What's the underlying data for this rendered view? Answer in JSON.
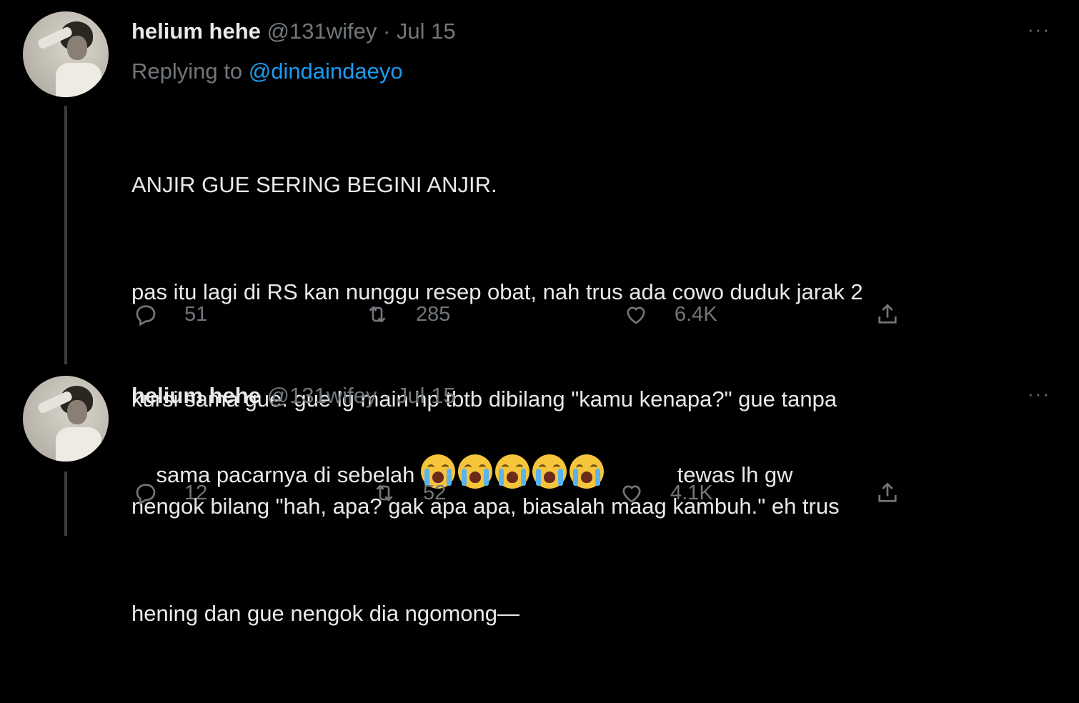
{
  "tweets": [
    {
      "name": "helium hehe",
      "handle": "@131wifey",
      "separator": "·",
      "date": "Jul 15",
      "more": "···",
      "replying_prefix": "Replying to ",
      "replying_to": "@dindaindaeyo",
      "lines": [
        "ANJIR GUE SERING BEGINI ANJIR.",
        "pas itu lagi di RS kan nunggu resep obat, nah trus ada cowo duduk jarak 2",
        "kursi sama gue. gue lg main hp tbtb dibilang \"kamu kenapa?\" gue tanpa",
        "nengok bilang \"hah, apa? gak apa apa, biasalah maag kambuh.\" eh trus",
        "hening dan gue nengok dia ngomong—"
      ],
      "replies": "51",
      "retweets": "285",
      "likes": "6.4K"
    },
    {
      "name": "helium hehe",
      "handle": "@131wifey",
      "separator": "·",
      "date": "Jul 15",
      "more": "···",
      "text_before": "sama pacarnya di sebelah ",
      "emoji_count": 5,
      "emoji_name": "loudly-crying-face",
      "text_after": " tewas lh gw",
      "replies": "12",
      "retweets": "52",
      "likes": "4.1K"
    }
  ],
  "colors": {
    "background": "#000000",
    "text": "#e7e9ea",
    "muted": "#71767b",
    "link": "#1d9bf0",
    "thread_line": "#3a3d40"
  }
}
